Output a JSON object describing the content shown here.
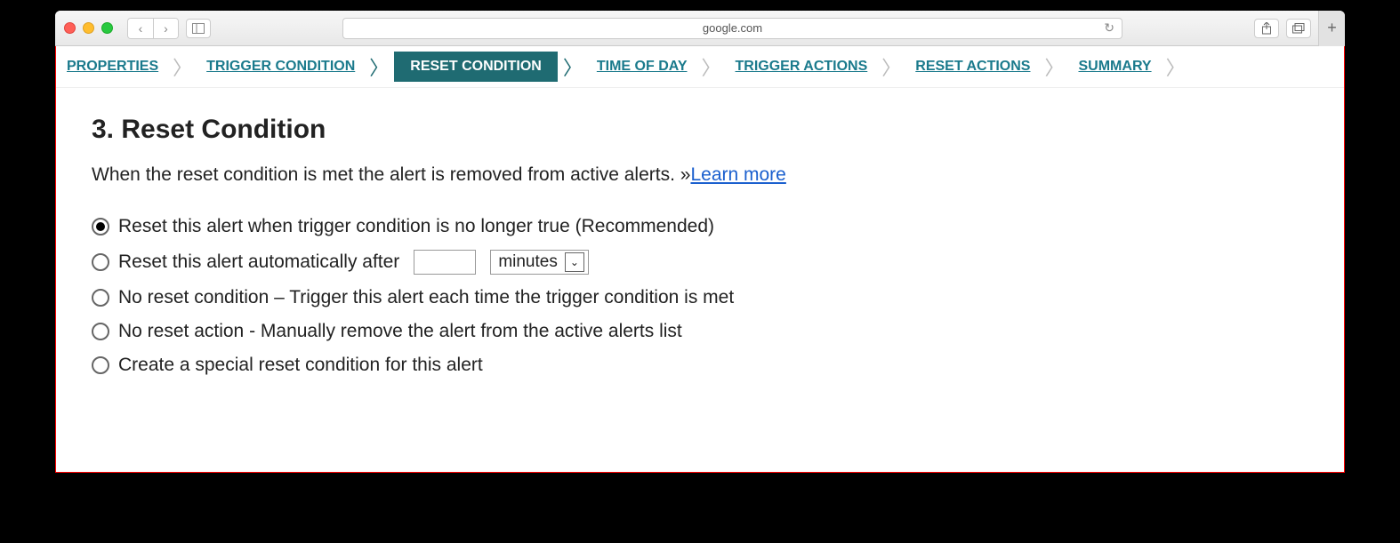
{
  "browser": {
    "address": "google.com"
  },
  "wizard": {
    "steps": {
      "properties": "PROPERTIES",
      "trigger_condition": "TRIGGER CONDITION",
      "reset_condition": "RESET CONDITION",
      "time_of_day": "TIME OF DAY",
      "trigger_actions": "TRIGGER ACTIONS",
      "reset_actions": "RESET ACTIONS",
      "summary": "SUMMARY"
    }
  },
  "page": {
    "heading": "3. Reset Condition",
    "description": "When the reset condition is met the alert is removed from active alerts. »",
    "learn_more": "Learn more",
    "options": {
      "opt1": "Reset this alert when trigger condition is no longer true (Recommended)",
      "opt2a": "Reset this alert automatically after",
      "opt2_unit": "minutes",
      "opt2_value": "",
      "opt3": "No reset condition – Trigger this alert each time the trigger condition is met",
      "opt4": "No reset action - Manually remove the alert from the active alerts list",
      "opt5": "Create a special reset condition for this alert"
    },
    "selected": "opt1"
  }
}
